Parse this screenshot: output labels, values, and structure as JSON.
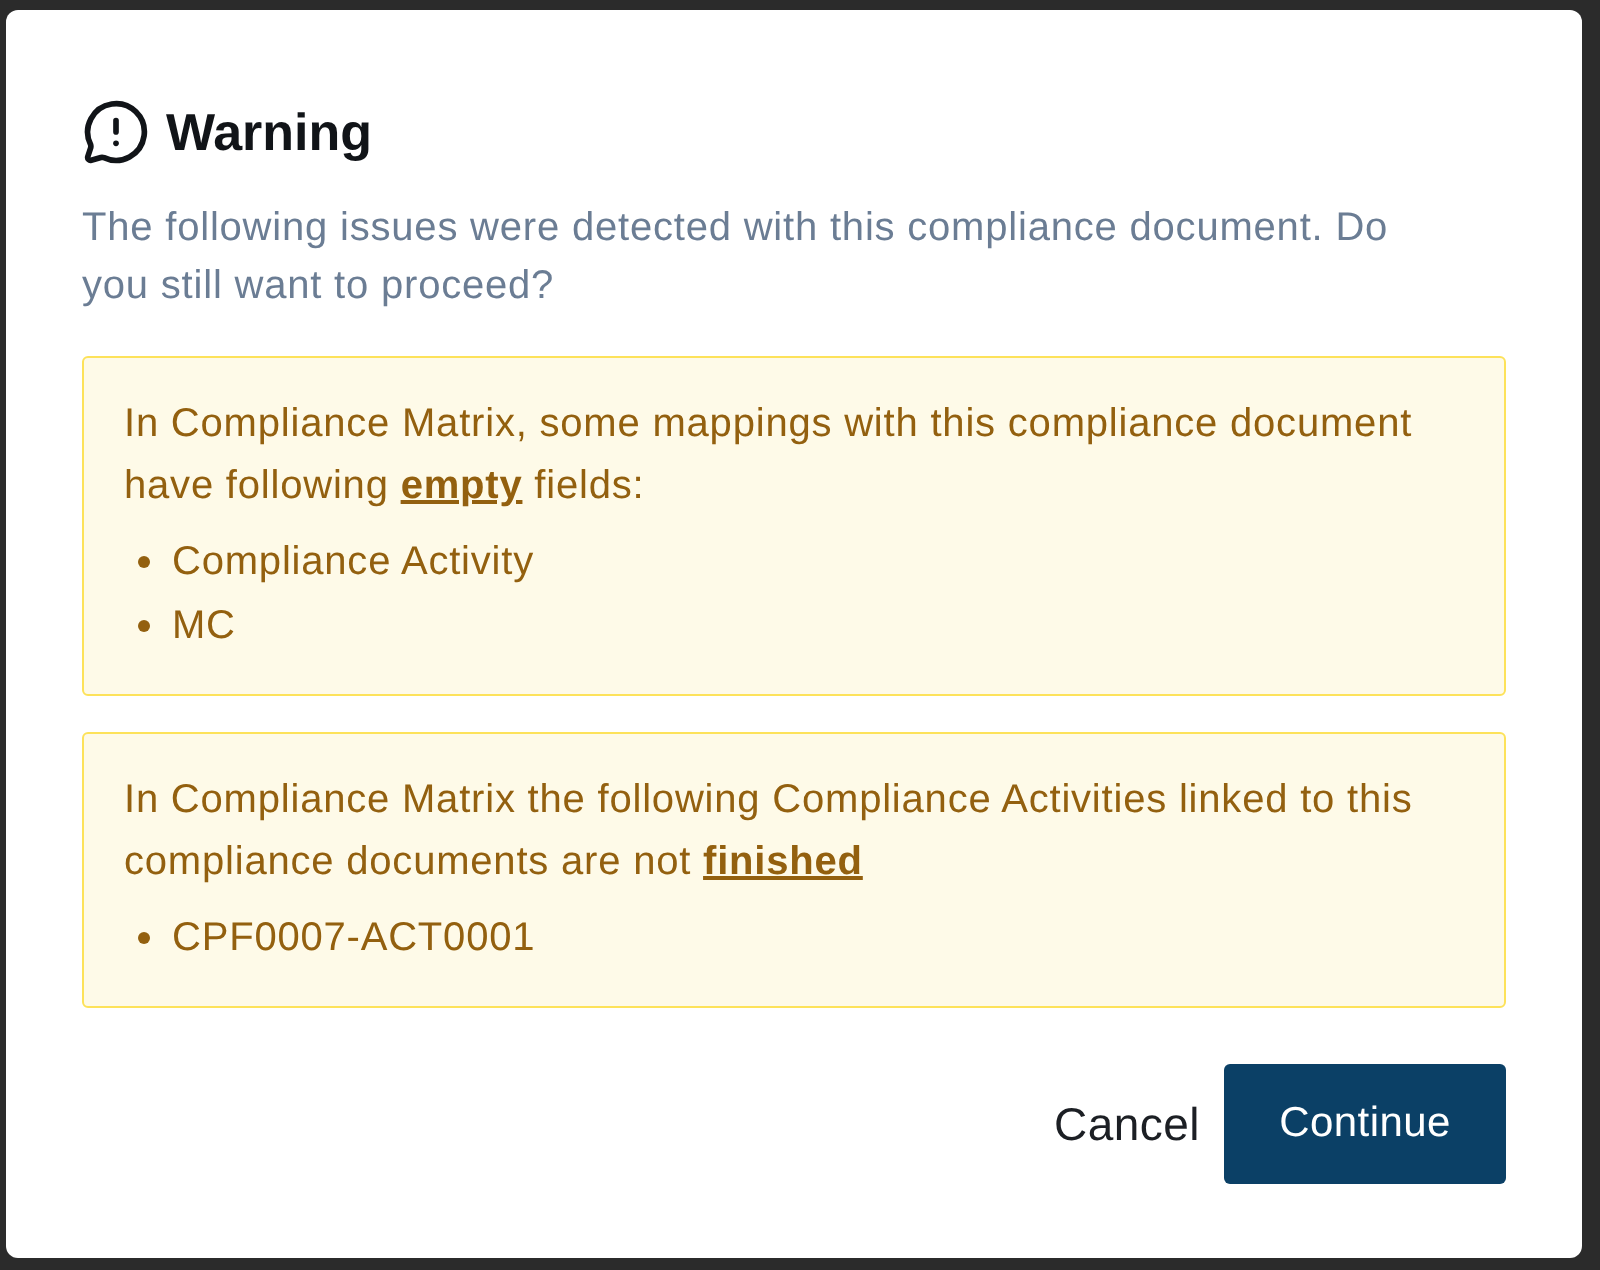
{
  "dialog": {
    "title": "Warning",
    "description": "The following issues were detected with this compliance document. Do you still want to proceed?",
    "issues": [
      {
        "message": "In Compliance Matrix, some mappings with this compliance document have following **empty** fields:",
        "items": [
          "Compliance Activity",
          "MC"
        ]
      },
      {
        "message": "In Compliance Matrix the following Compliance Activities linked to this compliance documents are not **finished**",
        "items": [
          "CPF0007-ACT0001"
        ]
      }
    ],
    "buttons": [
      {
        "label": "Cancel",
        "kind": "text"
      },
      {
        "label": "Continue",
        "kind": "primary"
      }
    ]
  }
}
